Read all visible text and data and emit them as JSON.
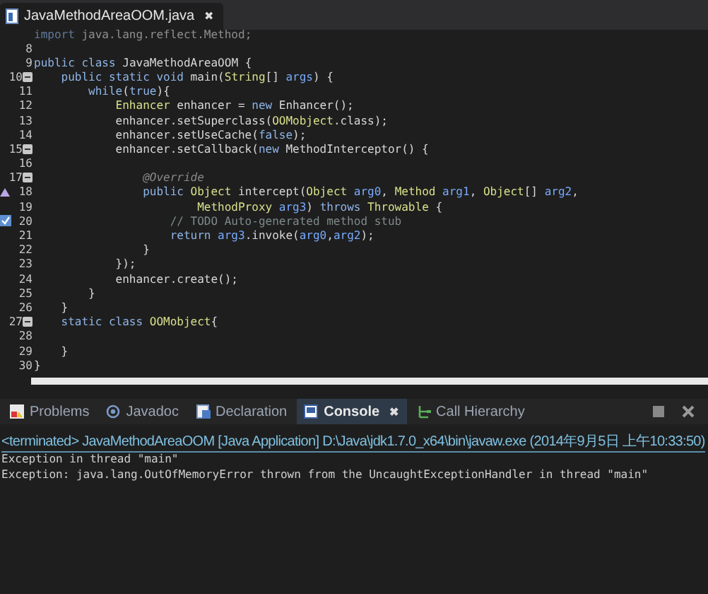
{
  "editor_tab": {
    "label": "JavaMethodAreaOOM.java",
    "close": "✖",
    "selected": true
  },
  "code_lines": [
    {
      "kind": "plain",
      "tokens": [
        {
          "kind": "kw",
          "text": "import "
        },
        {
          "kind": "plain",
          "text": "java.lang.reflect.Method;"
        }
      ]
    },
    {
      "kind": "plain",
      "number": "8"
    },
    {
      "kind": "plain",
      "number": "9",
      "tokens": [
        {
          "kind": "kw",
          "text": "public class "
        },
        {
          "kind": "plain",
          "text": "JavaMethodAreaOOM {"
        }
      ]
    },
    {
      "kind": "fold",
      "number": "10",
      "tokens": [
        {
          "kind": "kw",
          "text": "    public static void "
        },
        {
          "kind": "plain",
          "text": "main("
        },
        {
          "kind": "type",
          "text": "String"
        },
        {
          "kind": "plain",
          "text": "[] "
        },
        {
          "kind": "var",
          "text": "args"
        },
        {
          "kind": "plain",
          "text": ") {"
        }
      ]
    },
    {
      "kind": "plain",
      "number": "11",
      "tokens": [
        {
          "kind": "kw",
          "text": "        while"
        },
        {
          "kind": "plain",
          "text": "("
        },
        {
          "kind": "kw",
          "text": "true"
        },
        {
          "kind": "plain",
          "text": "){"
        }
      ]
    },
    {
      "kind": "plain",
      "number": "12",
      "tokens": [
        {
          "kind": "type",
          "text": "            Enhancer"
        },
        {
          "kind": "plain",
          "text": " enhancer = "
        },
        {
          "kind": "kw",
          "text": "new "
        },
        {
          "kind": "plain",
          "text": "Enhancer();"
        }
      ]
    },
    {
      "kind": "plain",
      "number": "13",
      "tokens": [
        {
          "kind": "plain",
          "text": "            enhancer.setSuperclass("
        },
        {
          "kind": "type",
          "text": "OOMobject"
        },
        {
          "kind": "plain",
          "text": ".class);"
        }
      ]
    },
    {
      "kind": "plain",
      "number": "14",
      "tokens": [
        {
          "kind": "plain",
          "text": "            enhancer.setUseCache("
        },
        {
          "kind": "kw",
          "text": "false"
        },
        {
          "kind": "plain",
          "text": ");"
        }
      ]
    },
    {
      "kind": "fold",
      "number": "15",
      "tokens": [
        {
          "kind": "plain",
          "text": "            enhancer.setCallback("
        },
        {
          "kind": "kw",
          "text": "new "
        },
        {
          "kind": "plain",
          "text": "MethodInterceptor() {"
        }
      ]
    },
    {
      "kind": "plain",
      "number": "16"
    },
    {
      "kind": "fold",
      "number": "17",
      "tokens": [
        {
          "kind": "ann",
          "text": "                @Override"
        }
      ]
    },
    {
      "kind": "override",
      "number": "18",
      "tokens": [
        {
          "kind": "kw",
          "text": "                public "
        },
        {
          "kind": "type",
          "text": "Object"
        },
        {
          "kind": "plain",
          "text": " intercept("
        },
        {
          "kind": "type",
          "text": "Object"
        },
        {
          "kind": "var",
          "text": " arg0"
        },
        {
          "kind": "plain",
          "text": ", "
        },
        {
          "kind": "type",
          "text": "Method"
        },
        {
          "kind": "var",
          "text": " arg1"
        },
        {
          "kind": "plain",
          "text": ", "
        },
        {
          "kind": "type",
          "text": "Object"
        },
        {
          "kind": "plain",
          "text": "[] "
        },
        {
          "kind": "var",
          "text": "arg2"
        },
        {
          "kind": "plain",
          "text": ","
        }
      ]
    },
    {
      "kind": "plain",
      "number": "19",
      "tokens": [
        {
          "kind": "type",
          "text": "                        MethodProxy"
        },
        {
          "kind": "var",
          "text": " arg3"
        },
        {
          "kind": "plain",
          "text": ") "
        },
        {
          "kind": "kw",
          "text": "throws "
        },
        {
          "kind": "type",
          "text": "Throwable"
        },
        {
          "kind": "plain",
          "text": " {"
        }
      ]
    },
    {
      "kind": "task",
      "number": "20",
      "tokens": [
        {
          "kind": "comment",
          "text": "                    // TODO Auto-generated method stub"
        }
      ]
    },
    {
      "kind": "plain",
      "number": "21",
      "tokens": [
        {
          "kind": "kw",
          "text": "                    return "
        },
        {
          "kind": "var",
          "text": "arg3"
        },
        {
          "kind": "plain",
          "text": ".invoke("
        },
        {
          "kind": "var",
          "text": "arg0"
        },
        {
          "kind": "plain",
          "text": ","
        },
        {
          "kind": "var",
          "text": "arg2"
        },
        {
          "kind": "plain",
          "text": ");"
        }
      ]
    },
    {
      "kind": "plain",
      "number": "22",
      "tokens": [
        {
          "kind": "plain",
          "text": "                }"
        }
      ]
    },
    {
      "kind": "plain",
      "number": "23",
      "tokens": [
        {
          "kind": "plain",
          "text": "            });"
        }
      ]
    },
    {
      "kind": "plain",
      "number": "24",
      "tokens": [
        {
          "kind": "plain",
          "text": "            enhancer.create();"
        }
      ]
    },
    {
      "kind": "plain",
      "number": "25",
      "tokens": [
        {
          "kind": "plain",
          "text": "        }"
        }
      ]
    },
    {
      "kind": "plain",
      "number": "26",
      "tokens": [
        {
          "kind": "plain",
          "text": "    }"
        }
      ]
    },
    {
      "kind": "fold",
      "number": "27",
      "tokens": [
        {
          "kind": "kw",
          "text": "    static class "
        },
        {
          "kind": "type",
          "text": "OOMobject"
        },
        {
          "kind": "plain",
          "text": "{"
        }
      ]
    },
    {
      "kind": "plain",
      "number": "28"
    },
    {
      "kind": "plain",
      "number": "29",
      "tokens": [
        {
          "kind": "plain",
          "text": "    }"
        }
      ]
    },
    {
      "kind": "plain",
      "number": "30",
      "tokens": [
        {
          "kind": "plain",
          "text": "}"
        }
      ]
    }
  ],
  "panel_tabs": [
    {
      "label": "Problems",
      "selected": false
    },
    {
      "label": "Javadoc",
      "selected": false
    },
    {
      "label": "Declaration",
      "selected": false
    },
    {
      "label": "Console",
      "selected": true,
      "close": "✖"
    },
    {
      "label": "Call Hierarchy",
      "selected": false
    }
  ],
  "console": {
    "header": "<terminated> JavaMethodAreaOOM [Java Application] D:\\Java\\jdk1.7.0_x64\\bin\\javaw.exe (2014年9月5日 上午10:33:50)",
    "lines": [
      "Exception in thread \"main\"",
      "Exception: java.lang.OutOfMemoryError thrown from the UncaughtExceptionHandler in thread \"main\""
    ]
  }
}
